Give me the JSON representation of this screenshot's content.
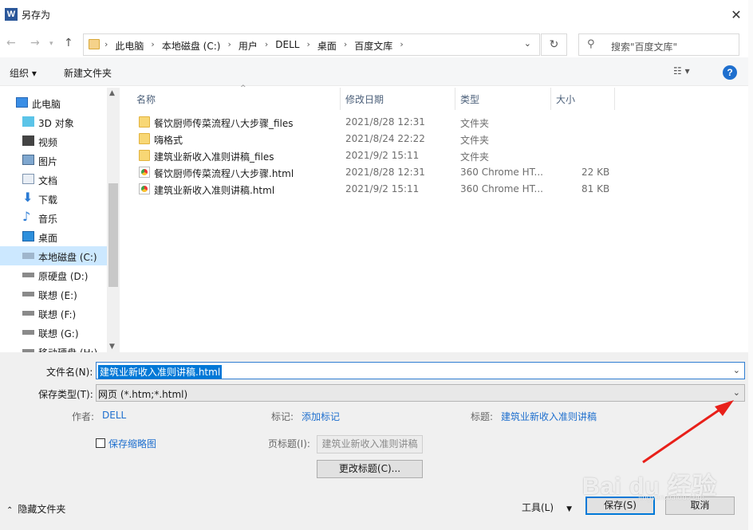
{
  "window": {
    "title": "另存为",
    "app_icon_letter": "W"
  },
  "address": {
    "crumbs": [
      "此电脑",
      "本地磁盘 (C:)",
      "用户",
      "DELL",
      "桌面",
      "百度文库"
    ]
  },
  "search": {
    "placeholder": "搜索\"百度文库\""
  },
  "toolbar": {
    "organize": "组织 ▾",
    "new_folder": "新建文件夹",
    "view": "☷ ▾",
    "help": "?"
  },
  "sidebar": {
    "items": [
      {
        "label": "此电脑",
        "icon": "computer-icon"
      },
      {
        "label": "3D 对象",
        "icon": "cube-icon"
      },
      {
        "label": "视频",
        "icon": "video-icon"
      },
      {
        "label": "图片",
        "icon": "picture-icon"
      },
      {
        "label": "文档",
        "icon": "document-icon"
      },
      {
        "label": "下载",
        "icon": "download-icon"
      },
      {
        "label": "音乐",
        "icon": "music-icon"
      },
      {
        "label": "桌面",
        "icon": "desktop-icon"
      },
      {
        "label": "本地磁盘 (C:)",
        "icon": "drive-icon"
      },
      {
        "label": "原硬盘 (D:)",
        "icon": "drive-icon"
      },
      {
        "label": "联想 (E:)",
        "icon": "drive-icon"
      },
      {
        "label": "联想 (F:)",
        "icon": "drive-icon"
      },
      {
        "label": "联想 (G:)",
        "icon": "drive-icon"
      },
      {
        "label": "移动硬盘 (H:)",
        "icon": "drive-icon"
      }
    ]
  },
  "files": {
    "columns": [
      "名称",
      "修改日期",
      "类型",
      "大小"
    ],
    "rows": [
      {
        "name": "餐饮厨师传菜流程八大步骤_files",
        "date": "2021/8/28 12:31",
        "type": "文件夹",
        "size": "",
        "icon": "folder-icon"
      },
      {
        "name": "嗨格式",
        "date": "2021/8/24 22:22",
        "type": "文件夹",
        "size": "",
        "icon": "folder-icon"
      },
      {
        "name": "建筑业新收入准则讲稿_files",
        "date": "2021/9/2 15:11",
        "type": "文件夹",
        "size": "",
        "icon": "folder-icon"
      },
      {
        "name": "餐饮厨师传菜流程八大步骤.html",
        "date": "2021/8/28 12:31",
        "type": "360 Chrome HT...",
        "size": "22 KB",
        "icon": "html-file-icon"
      },
      {
        "name": "建筑业新收入准则讲稿.html",
        "date": "2021/9/2 15:11",
        "type": "360 Chrome HT...",
        "size": "81 KB",
        "icon": "html-file-icon"
      }
    ]
  },
  "form": {
    "filename_label": "文件名(N):",
    "filename_value": "建筑业新收入准则讲稿.html",
    "filetype_label": "保存类型(T):",
    "filetype_value": "网页 (*.htm;*.html)",
    "author_label": "作者:",
    "author_value": "DELL",
    "tags_label": "标记:",
    "tags_value": "添加标记",
    "title_label": "标题:",
    "title_value": "建筑业新收入准则讲稿",
    "thumbnail_label": "保存缩略图",
    "page_title_label": "页标题(I):",
    "page_title_value": "建筑业新收入准则讲稿",
    "change_title_button": "更改标题(C)...",
    "hide_folders": "隐藏文件夹",
    "tools": "工具(L)",
    "save_button": "保存(S)",
    "cancel_button": "取消"
  },
  "watermark": {
    "text": "Bai du 经验",
    "sub": "jingyan.baidu.com"
  },
  "colors": {
    "accent": "#0078d7",
    "link": "#1e6fce",
    "annotation_arrow": "#e8201a",
    "selected_bg": "#cce8ff"
  }
}
